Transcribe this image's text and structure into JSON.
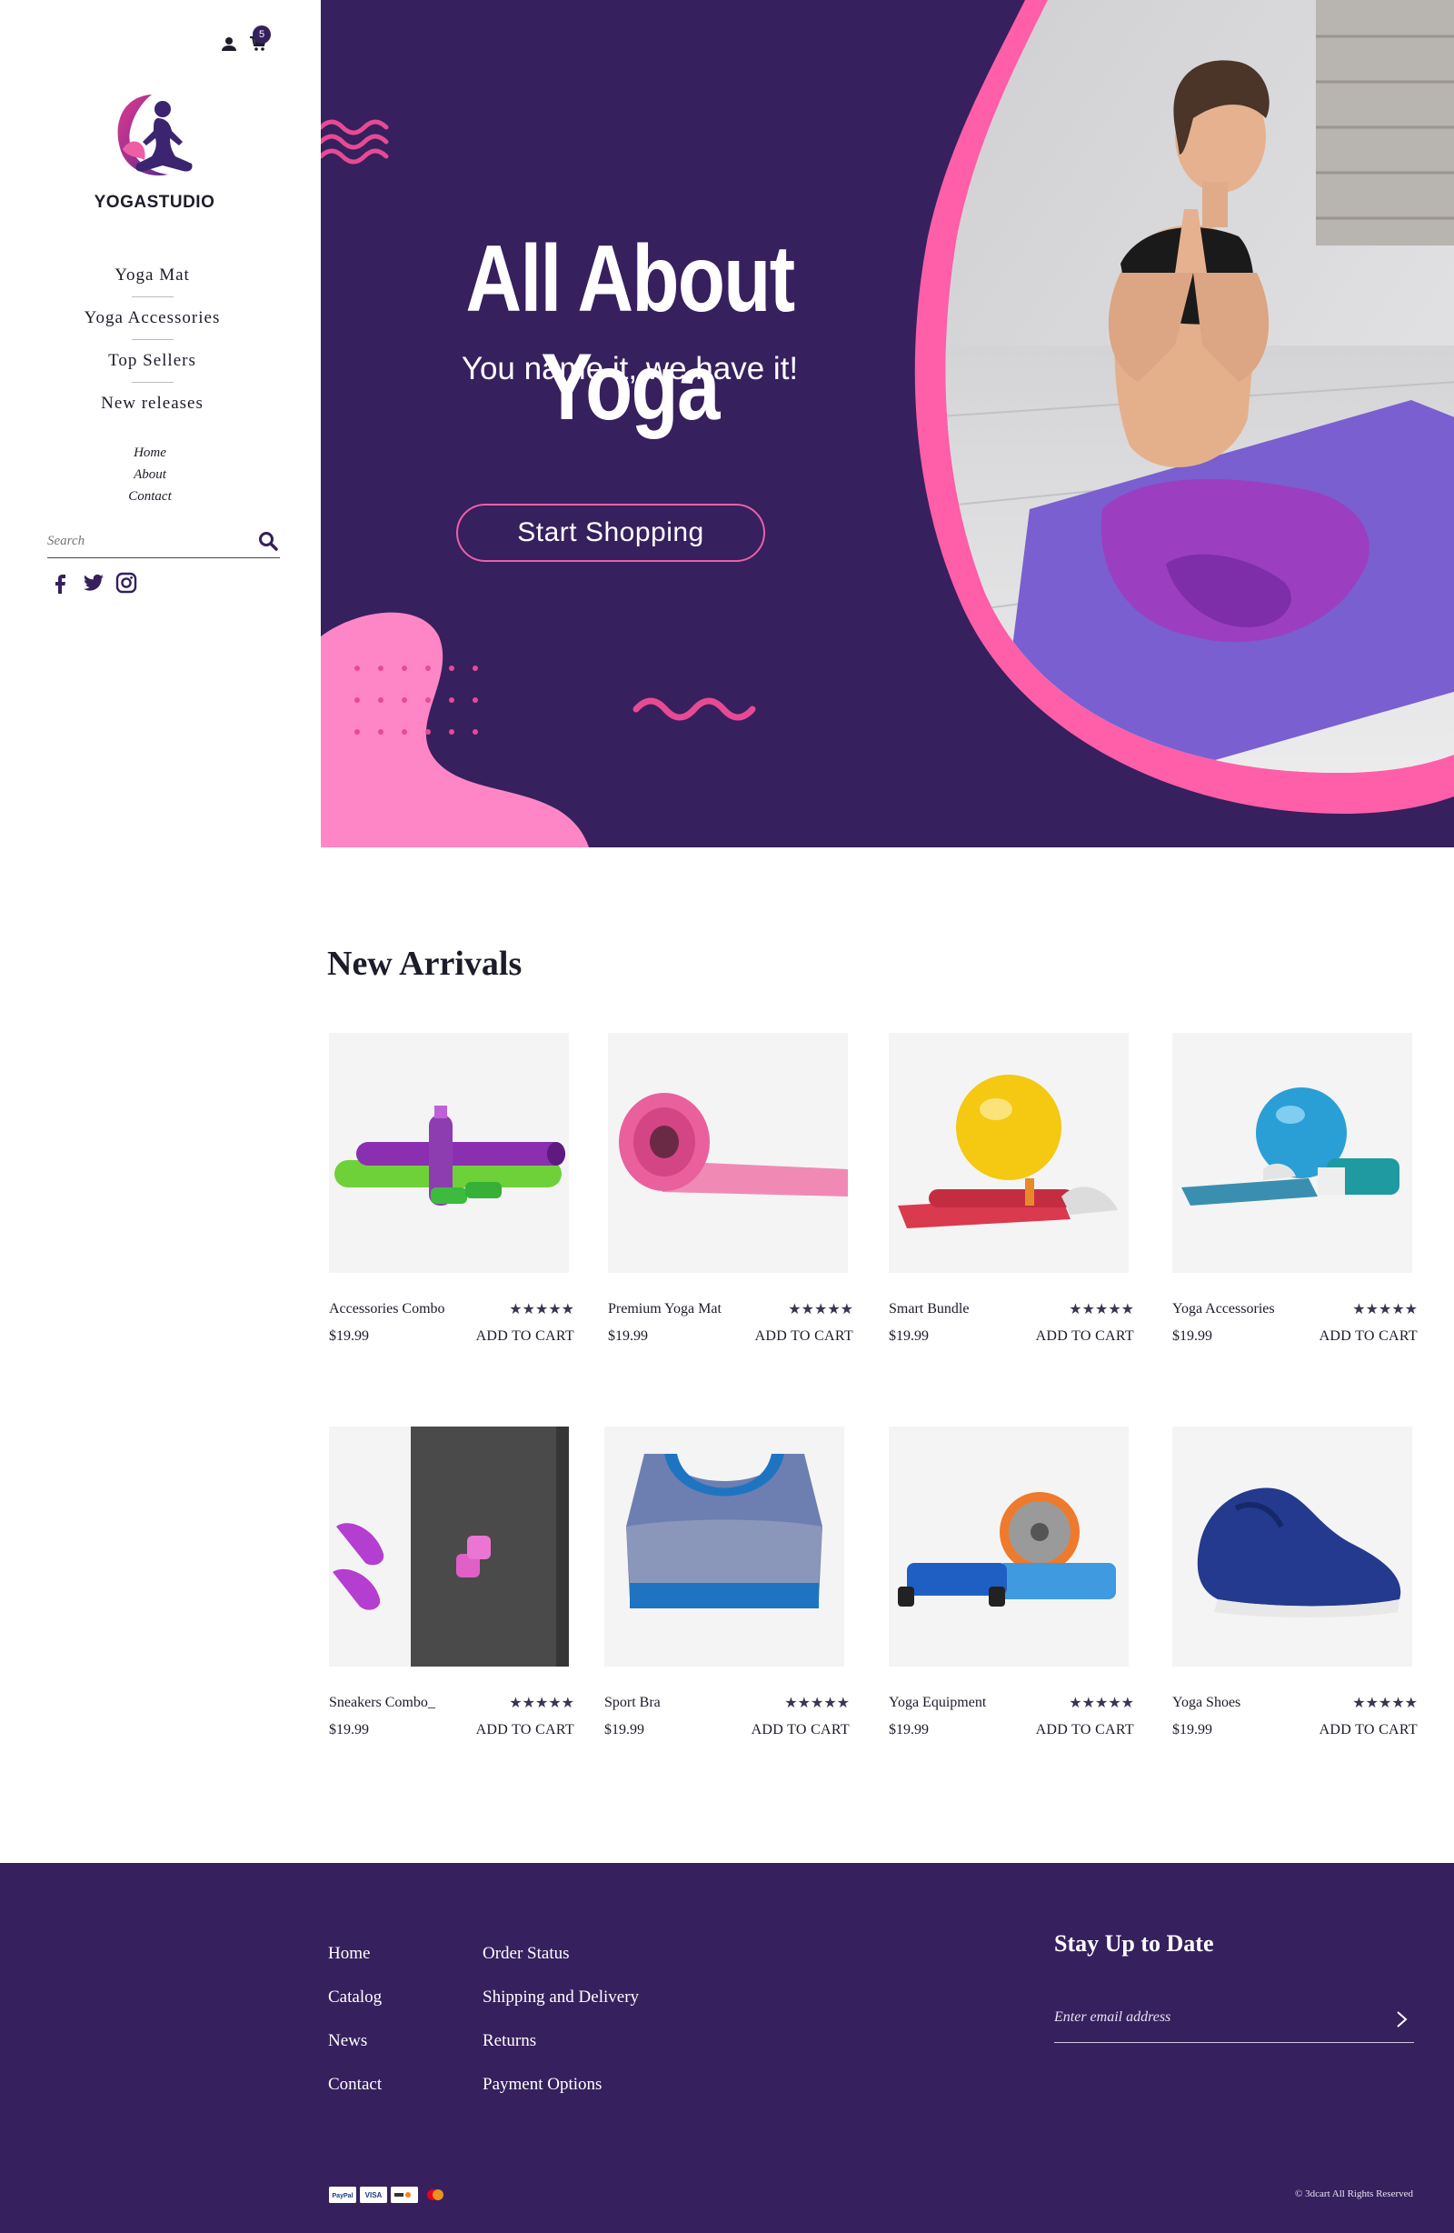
{
  "header": {
    "cart_count": "5"
  },
  "brand": {
    "name": "YOGASTUDIO"
  },
  "sidebar": {
    "main_nav": [
      "Yoga Mat",
      "Yoga Accessories",
      "Top Sellers",
      "New releases"
    ],
    "sub_nav": [
      "Home",
      "About",
      "Contact"
    ],
    "search_placeholder": "Search",
    "social_icons": [
      "facebook-icon",
      "twitter-icon",
      "instagram-icon"
    ]
  },
  "hero": {
    "title": "All About Yoga",
    "subtitle": "You name it, we have it!",
    "cta": "Start Shopping",
    "colors": {
      "background": "#36205e",
      "accent": "#ff5ea8"
    }
  },
  "new_arrivals": {
    "title": "New Arrivals",
    "rating_stars": "★★★★★",
    "add_to_cart_label": "ADD TO CART",
    "products": [
      {
        "name": "Accessories Combo",
        "price": "$19.99"
      },
      {
        "name": "Premium Yoga Mat",
        "price": "$19.99"
      },
      {
        "name": "Smart Bundle",
        "price": "$19.99"
      },
      {
        "name": "Yoga Accessories",
        "price": "$19.99"
      },
      {
        "name": "Sneakers Combo_",
        "price": "$19.99"
      },
      {
        "name": "Sport Bra",
        "price": "$19.99"
      },
      {
        "name": "Yoga Equipment",
        "price": "$19.99"
      },
      {
        "name": "Yoga Shoes",
        "price": "$19.99"
      }
    ]
  },
  "footer": {
    "col1": [
      "Home",
      "Catalog",
      "News",
      "Contact"
    ],
    "col2": [
      "Order Status",
      "Shipping and Delivery",
      "Returns",
      "Payment Options"
    ],
    "newsletter_title": "Stay Up to Date",
    "email_placeholder": "Enter email address",
    "payment_icons": [
      "paypal-icon",
      "visa-icon",
      "discover-icon",
      "mastercard-icon"
    ],
    "copyright": "© 3dcart All Rights Reserved"
  }
}
